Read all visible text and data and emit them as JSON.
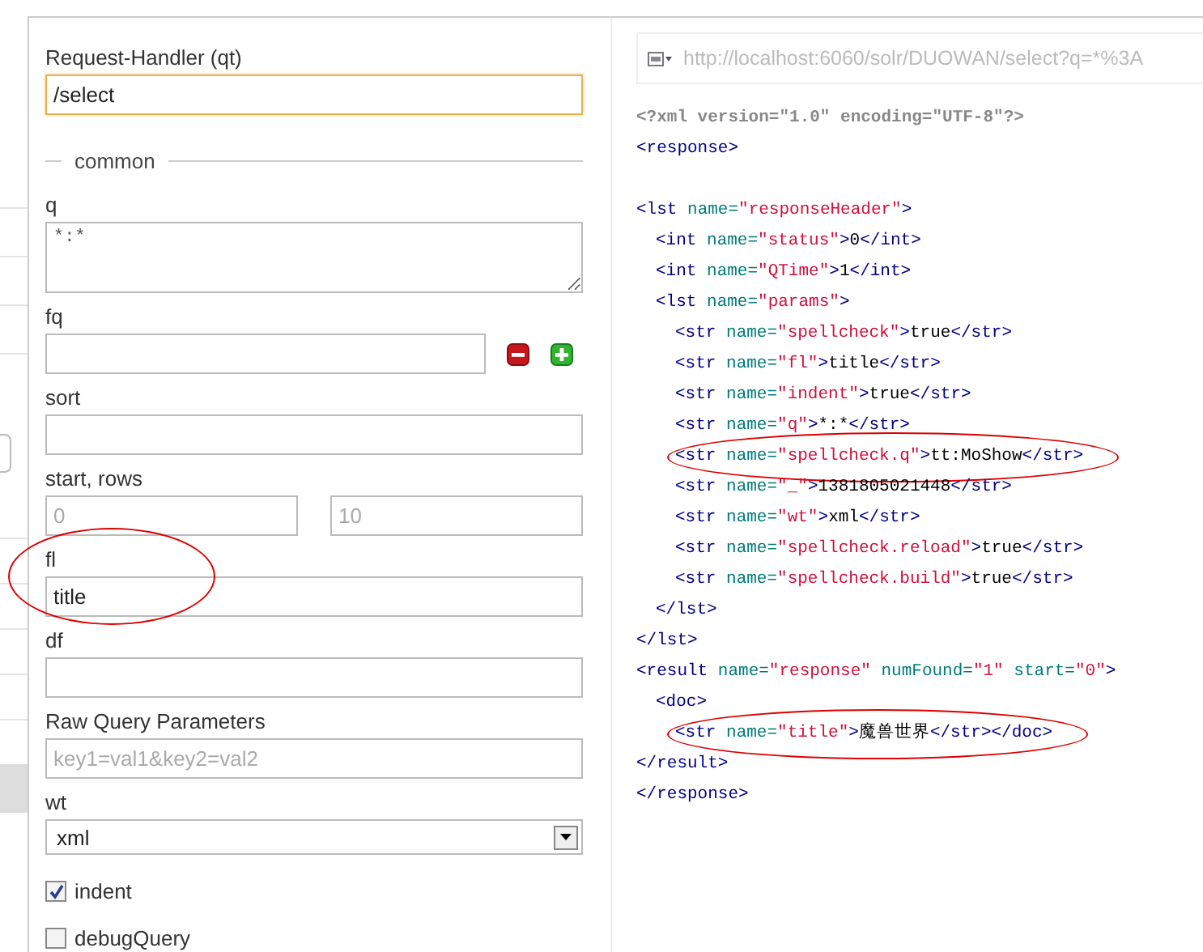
{
  "request_handler": {
    "label": "Request-Handler (qt)",
    "value": "/select",
    "focused": true
  },
  "section": {
    "legend": "common"
  },
  "fields": [
    {
      "kind": "textarea",
      "label": "q",
      "value": "*:*"
    },
    {
      "kind": "filter",
      "label": "fq"
    },
    {
      "kind": "text",
      "label": "sort"
    },
    {
      "kind": "pair",
      "label": "start, rows",
      "placeholders": [
        "0",
        "10"
      ]
    },
    {
      "kind": "text",
      "label": "fl",
      "value": "title",
      "circled": true
    },
    {
      "kind": "text",
      "label": "df"
    },
    {
      "kind": "text",
      "label": "Raw Query Parameters",
      "placeholder": "key1=val1&key2=val2"
    },
    {
      "kind": "select",
      "label": "wt",
      "value": "xml"
    },
    {
      "kind": "checkbox",
      "label": "indent",
      "checked": true
    },
    {
      "kind": "checkbox",
      "label": "debugQuery",
      "checked": false
    }
  ],
  "url_bar": {
    "url": "http://localhost:6060/solr/DUOWAN/select?q=*%3A"
  },
  "xml": [
    {
      "kind": "line",
      "tokens": [
        {
          "kind": "decl",
          "text": "<?xml version=\"1.0\" encoding=\"UTF-8\"?>"
        }
      ]
    },
    {
      "kind": "line",
      "tokens": [
        {
          "kind": "tag",
          "text": "<response>"
        }
      ]
    },
    {
      "kind": "blank"
    },
    {
      "kind": "line",
      "tokens": [
        {
          "kind": "tag",
          "text": "<lst"
        },
        {
          "kind": "attr",
          "text": " name="
        },
        {
          "kind": "value",
          "text": "\"responseHeader\""
        },
        {
          "kind": "tag",
          "text": ">"
        }
      ],
      "children": [
        {
          "kind": "line",
          "tokens": [
            {
              "kind": "tag",
              "text": "<int"
            },
            {
              "kind": "attr",
              "text": " name="
            },
            {
              "kind": "value",
              "text": "\"status\""
            },
            {
              "kind": "tag",
              "text": ">"
            },
            {
              "kind": "text",
              "text": "0"
            },
            {
              "kind": "tag",
              "text": "</int>"
            }
          ]
        },
        {
          "kind": "line",
          "tokens": [
            {
              "kind": "tag",
              "text": "<int"
            },
            {
              "kind": "attr",
              "text": " name="
            },
            {
              "kind": "value",
              "text": "\"QTime\""
            },
            {
              "kind": "tag",
              "text": ">"
            },
            {
              "kind": "text",
              "text": "1"
            },
            {
              "kind": "tag",
              "text": "</int>"
            }
          ]
        },
        {
          "kind": "line",
          "tokens": [
            {
              "kind": "tag",
              "text": "<lst"
            },
            {
              "kind": "attr",
              "text": " name="
            },
            {
              "kind": "value",
              "text": "\"params\""
            },
            {
              "kind": "tag",
              "text": ">"
            }
          ],
          "children": [
            {
              "kind": "line",
              "tokens": [
                {
                  "kind": "tag",
                  "text": "<str"
                },
                {
                  "kind": "attr",
                  "text": " name="
                },
                {
                  "kind": "value",
                  "text": "\"spellcheck\""
                },
                {
                  "kind": "tag",
                  "text": ">"
                },
                {
                  "kind": "text",
                  "text": "true"
                },
                {
                  "kind": "tag",
                  "text": "</str>"
                }
              ]
            },
            {
              "kind": "line",
              "tokens": [
                {
                  "kind": "tag",
                  "text": "<str"
                },
                {
                  "kind": "attr",
                  "text": " name="
                },
                {
                  "kind": "value",
                  "text": "\"fl\""
                },
                {
                  "kind": "tag",
                  "text": ">"
                },
                {
                  "kind": "text",
                  "text": "title"
                },
                {
                  "kind": "tag",
                  "text": "</str>"
                }
              ]
            },
            {
              "kind": "line",
              "tokens": [
                {
                  "kind": "tag",
                  "text": "<str"
                },
                {
                  "kind": "attr",
                  "text": " name="
                },
                {
                  "kind": "value",
                  "text": "\"indent\""
                },
                {
                  "kind": "tag",
                  "text": ">"
                },
                {
                  "kind": "text",
                  "text": "true"
                },
                {
                  "kind": "tag",
                  "text": "</str>"
                }
              ]
            },
            {
              "kind": "line",
              "tokens": [
                {
                  "kind": "tag",
                  "text": "<str"
                },
                {
                  "kind": "attr",
                  "text": " name="
                },
                {
                  "kind": "value",
                  "text": "\"q\""
                },
                {
                  "kind": "tag",
                  "text": ">"
                },
                {
                  "kind": "text",
                  "text": "*:*"
                },
                {
                  "kind": "tag",
                  "text": "</str>"
                }
              ]
            },
            {
              "kind": "line",
              "circled": true,
              "tokens": [
                {
                  "kind": "tag",
                  "text": "<str"
                },
                {
                  "kind": "attr",
                  "text": " name="
                },
                {
                  "kind": "value",
                  "text": "\"spellcheck.q\""
                },
                {
                  "kind": "tag",
                  "text": ">"
                },
                {
                  "kind": "text",
                  "text": "tt:MoShow"
                },
                {
                  "kind": "tag",
                  "text": "</str>"
                }
              ]
            },
            {
              "kind": "line",
              "tokens": [
                {
                  "kind": "tag",
                  "text": "<str"
                },
                {
                  "kind": "attr",
                  "text": " name="
                },
                {
                  "kind": "value",
                  "text": "\"_\""
                },
                {
                  "kind": "tag",
                  "text": ">"
                },
                {
                  "kind": "text",
                  "text": "1381805021448"
                },
                {
                  "kind": "tag",
                  "text": "</str>"
                }
              ]
            },
            {
              "kind": "line",
              "tokens": [
                {
                  "kind": "tag",
                  "text": "<str"
                },
                {
                  "kind": "attr",
                  "text": " name="
                },
                {
                  "kind": "value",
                  "text": "\"wt\""
                },
                {
                  "kind": "tag",
                  "text": ">"
                },
                {
                  "kind": "text",
                  "text": "xml"
                },
                {
                  "kind": "tag",
                  "text": "</str>"
                }
              ]
            },
            {
              "kind": "line",
              "tokens": [
                {
                  "kind": "tag",
                  "text": "<str"
                },
                {
                  "kind": "attr",
                  "text": " name="
                },
                {
                  "kind": "value",
                  "text": "\"spellcheck.reload\""
                },
                {
                  "kind": "tag",
                  "text": ">"
                },
                {
                  "kind": "text",
                  "text": "true"
                },
                {
                  "kind": "tag",
                  "text": "</str>"
                }
              ]
            },
            {
              "kind": "line",
              "tokens": [
                {
                  "kind": "tag",
                  "text": "<str"
                },
                {
                  "kind": "attr",
                  "text": " name="
                },
                {
                  "kind": "value",
                  "text": "\"spellcheck.build\""
                },
                {
                  "kind": "tag",
                  "text": ">"
                },
                {
                  "kind": "text",
                  "text": "true"
                },
                {
                  "kind": "tag",
                  "text": "</str>"
                }
              ]
            }
          ]
        },
        {
          "kind": "line",
          "tokens": [
            {
              "kind": "tag",
              "text": "</lst>"
            }
          ]
        }
      ]
    },
    {
      "kind": "line",
      "tokens": [
        {
          "kind": "tag",
          "text": "</lst>"
        }
      ]
    },
    {
      "kind": "line",
      "tokens": [
        {
          "kind": "tag",
          "text": "<result"
        },
        {
          "kind": "attr",
          "text": " name="
        },
        {
          "kind": "value",
          "text": "\"response\""
        },
        {
          "kind": "attr",
          "text": " numFound="
        },
        {
          "kind": "value",
          "text": "\"1\""
        },
        {
          "kind": "attr",
          "text": " start="
        },
        {
          "kind": "value",
          "text": "\"0\""
        },
        {
          "kind": "tag",
          "text": ">"
        }
      ],
      "children": [
        {
          "kind": "line",
          "tokens": [
            {
              "kind": "tag",
              "text": "<doc>"
            }
          ],
          "children": [
            {
              "kind": "line",
              "circled": true,
              "tokens": [
                {
                  "kind": "tag",
                  "text": "<str"
                },
                {
                  "kind": "attr",
                  "text": " name="
                },
                {
                  "kind": "value",
                  "text": "\"title\""
                },
                {
                  "kind": "tag",
                  "text": ">"
                },
                {
                  "kind": "text",
                  "text": "魔兽世界"
                },
                {
                  "kind": "tag",
                  "text": "</str></doc>"
                }
              ]
            }
          ]
        }
      ]
    },
    {
      "kind": "line",
      "tokens": [
        {
          "kind": "tag",
          "text": "</result>"
        }
      ]
    },
    {
      "kind": "line",
      "tokens": [
        {
          "kind": "tag",
          "text": "</response>"
        }
      ]
    }
  ]
}
